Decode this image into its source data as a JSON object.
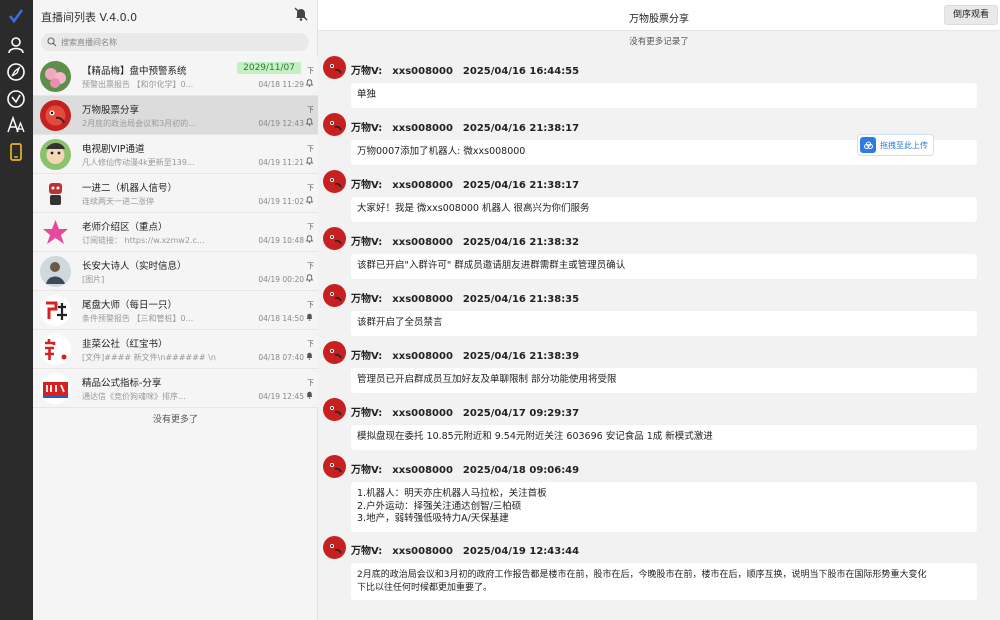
{
  "rail": {
    "icons": [
      "check-logo-icon",
      "user-icon",
      "compass-icon",
      "dashboard-icon",
      "font-icon",
      "phone-icon"
    ],
    "active_color": "#e6b422"
  },
  "list": {
    "title": "直播间列表 V.4.0.0",
    "search_placeholder": "搜索直播间名称",
    "more": "没有更多了",
    "chats": [
      {
        "name": "【精品梅】盘中预警系统",
        "preview": "预警出票报告 【和尔化学】0...",
        "time": "04/18 11:29",
        "badge": "2029/11/07",
        "pin": "下"
      },
      {
        "name": "万物股票分享",
        "preview": "2月底的政治局会议和3月初的...",
        "time": "04/19 12:43",
        "badge": "",
        "pin": "下"
      },
      {
        "name": "电视剧VIP通道",
        "preview": "凡人修仙传动漫4k更新至139...",
        "time": "04/19 11:21",
        "badge": "",
        "pin": "下"
      },
      {
        "name": "一进二（机器人信号）",
        "preview": "连续两天一进二涨停",
        "time": "04/19 11:02",
        "badge": "",
        "pin": "下"
      },
      {
        "name": "老师介绍区（重点）",
        "preview": "订阅链接： https://w.xzmw2.c...",
        "time": "04/19 10:48",
        "badge": "",
        "pin": "下"
      },
      {
        "name": "长安大诗人（实时信息）",
        "preview": "[图片]",
        "time": "04/19 00:20",
        "badge": "",
        "pin": "下"
      },
      {
        "name": "尾盘大师（每日一只）",
        "preview": "条件预警报告 【三和管桩】0...",
        "time": "04/18 14:50",
        "badge": "",
        "pin": "下"
      },
      {
        "name": "韭菜公社（红宝书）",
        "preview": "[文件]#### 新文件\\n###### \\n",
        "time": "04/18 07:40",
        "badge": "",
        "pin": "下"
      },
      {
        "name": "精品公式指标-分享",
        "preview": "通达信《竞价狗魂咪》排序...",
        "time": "04/19 12:45",
        "badge": "",
        "pin": "下"
      }
    ]
  },
  "main": {
    "title": "万物股票分享",
    "reverse_label": "倒序观看",
    "no_more": "没有更多记录了",
    "upload_label": "拖拽至此上传",
    "messages": [
      {
        "sender": "万物V:",
        "id": "xxs008000",
        "datetime": "2025/04/16 16:44:55",
        "lines": [
          "单独"
        ]
      },
      {
        "sender": "万物V:",
        "id": "xxs008000",
        "datetime": "2025/04/16 21:38:17",
        "lines": [
          "万物0007添加了机器人: 微xxs008000"
        ]
      },
      {
        "sender": "万物V:",
        "id": "xxs008000",
        "datetime": "2025/04/16 21:38:17",
        "lines": [
          "大家好！我是 微xxs008000 机器人 很高兴为你们服务"
        ]
      },
      {
        "sender": "万物V:",
        "id": "xxs008000",
        "datetime": "2025/04/16 21:38:32",
        "lines": [
          "该群已开启\"入群许可\" 群成员邀请朋友进群需群主或管理员确认"
        ]
      },
      {
        "sender": "万物V:",
        "id": "xxs008000",
        "datetime": "2025/04/16 21:38:35",
        "lines": [
          "该群开启了全员禁言"
        ]
      },
      {
        "sender": "万物V:",
        "id": "xxs008000",
        "datetime": "2025/04/16 21:38:39",
        "lines": [
          "管理员已开启群成员互加好友及单聊限制 部分功能使用将受限"
        ]
      },
      {
        "sender": "万物V:",
        "id": "xxs008000",
        "datetime": "2025/04/17 09:29:37",
        "lines": [
          "模拟盘现在委托 10.85元附近和 9.54元附近关注 603696 安记食品 1成 新模式激进"
        ]
      },
      {
        "sender": "万物V:",
        "id": "xxs008000",
        "datetime": "2025/04/18 09:06:49",
        "lines": [
          "1.机器人：明天亦庄机器人马拉松，关注首板",
          "2.户外运动：择强关注通达创智/三柏硕",
          "3.地产，弱转强低吸特力A/天保基建"
        ]
      },
      {
        "sender": "万物V:",
        "id": "xxs008000",
        "datetime": "2025/04/19 12:43:44",
        "lines": [
          "2月底的政治局会议和3月初的政府工作报告都是楼市在前，股市在后，今晚股市在前，楼市在后，顺序互换，说明当下股市在国际形势重大变化",
          "下比以往任何时候都更加重要了。"
        ]
      }
    ]
  }
}
